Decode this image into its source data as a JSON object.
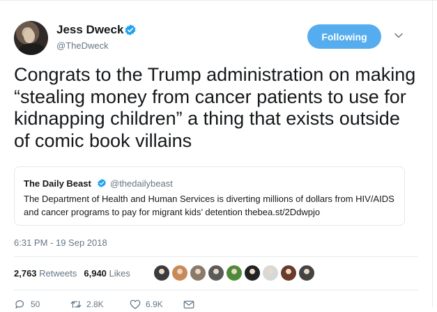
{
  "author": {
    "name": "Jess Dweck",
    "handle": "@TheDweck"
  },
  "follow_button": {
    "label": "Following"
  },
  "tweet": {
    "text": "Congrats to the Trump administration on making “stealing money from cancer patients to use for kidnapping children” a thing that exists outside of comic book villains"
  },
  "quoted_tweet": {
    "name": "The Daily Beast",
    "handle": "@thedailybeast",
    "text": "The Department of Health and Human Services is diverting millions of dollars from HIV/AIDS and cancer programs to pay for migrant kids’ detention thebea.st/2Ddwpjo"
  },
  "timestamp": "6:31 PM - 19 Sep 2018",
  "stats": {
    "retweets_count": "2,763",
    "retweets_label": "Retweets",
    "likes_count": "6,940",
    "likes_label": "Likes"
  },
  "liker_avatars": [
    {
      "color": "#3b3b3b"
    },
    {
      "color": "#c98a5a"
    },
    {
      "color": "#8a7a6a"
    },
    {
      "color": "#5a5a5a"
    },
    {
      "color": "#4f8a3a"
    },
    {
      "color": "#222222"
    },
    {
      "color": "#d8d8d8"
    },
    {
      "color": "#6a3a2a"
    },
    {
      "color": "#444444"
    }
  ],
  "actions": {
    "reply_count": "50",
    "retweet_count": "2.8K",
    "like_count": "6.9K"
  },
  "colors": {
    "accent": "#55acee",
    "verified": "#1da1f2",
    "muted_text": "#657786"
  }
}
